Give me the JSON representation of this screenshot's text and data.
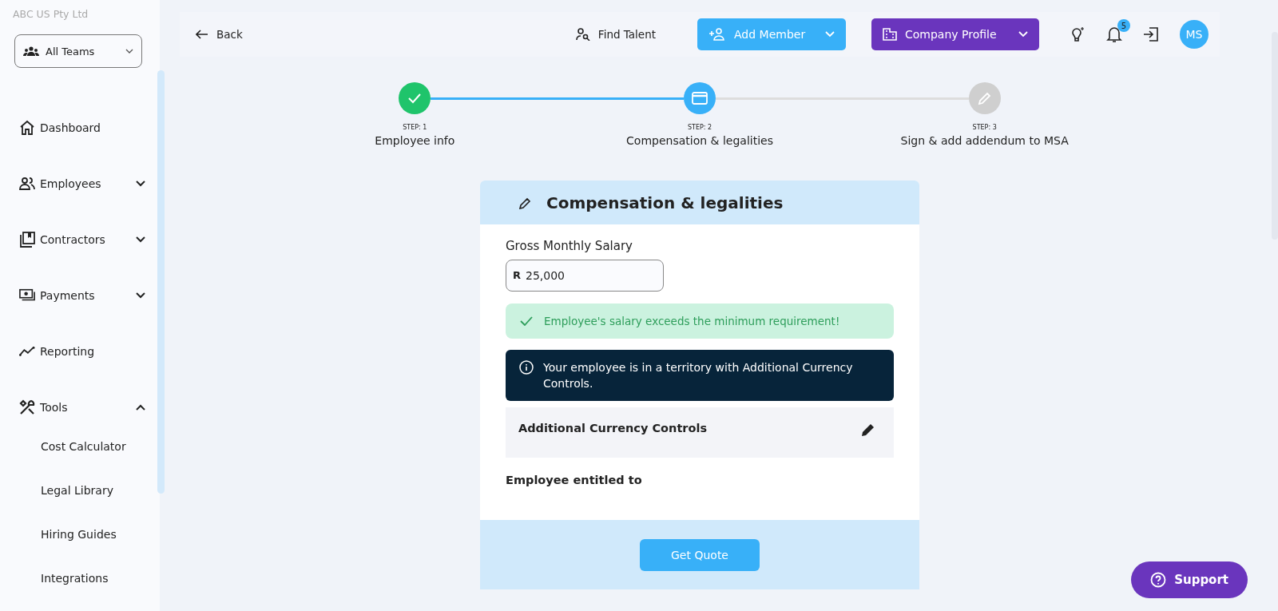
{
  "sidebar": {
    "company": "ABC US Pty Ltd",
    "team_select": {
      "value": "All Teams"
    },
    "items": [
      {
        "label": "Dashboard"
      },
      {
        "label": "Employees",
        "expanded": false
      },
      {
        "label": "Contractors",
        "expanded": false
      },
      {
        "label": "Payments",
        "expanded": false
      },
      {
        "label": "Reporting"
      },
      {
        "label": "Tools",
        "expanded": true,
        "children": [
          {
            "label": "Cost Calculator"
          },
          {
            "label": "Legal Library"
          },
          {
            "label": "Hiring Guides"
          },
          {
            "label": "Integrations"
          }
        ]
      }
    ]
  },
  "topbar": {
    "back": "Back",
    "find_talent": "Find Talent",
    "add_member": "Add Member",
    "company_profile": "Company Profile",
    "notifications": "5",
    "avatar": "MS"
  },
  "stepper": [
    {
      "step": "STEP: 1",
      "label": "Employee info",
      "completed": true,
      "selected": false
    },
    {
      "step": "STEP: 2",
      "label": "Compensation & legalities",
      "completed": false,
      "selected": true
    },
    {
      "step": "STEP: 3",
      "label": "Sign & add addendum to MSA",
      "completed": false,
      "selected": false
    }
  ],
  "card": {
    "title": "Compensation & legalities",
    "salary_label": "Gross Monthly Salary",
    "currency": "R",
    "salary": "25,000",
    "success": "Employee's salary exceeds the minimum requirement!",
    "info": "Your employee is in a territory with Additional Currency Controls.",
    "section": "Additional Currency Controls",
    "entitled": "Employee entitled to",
    "button": "Get Quote"
  },
  "support": "Support"
}
